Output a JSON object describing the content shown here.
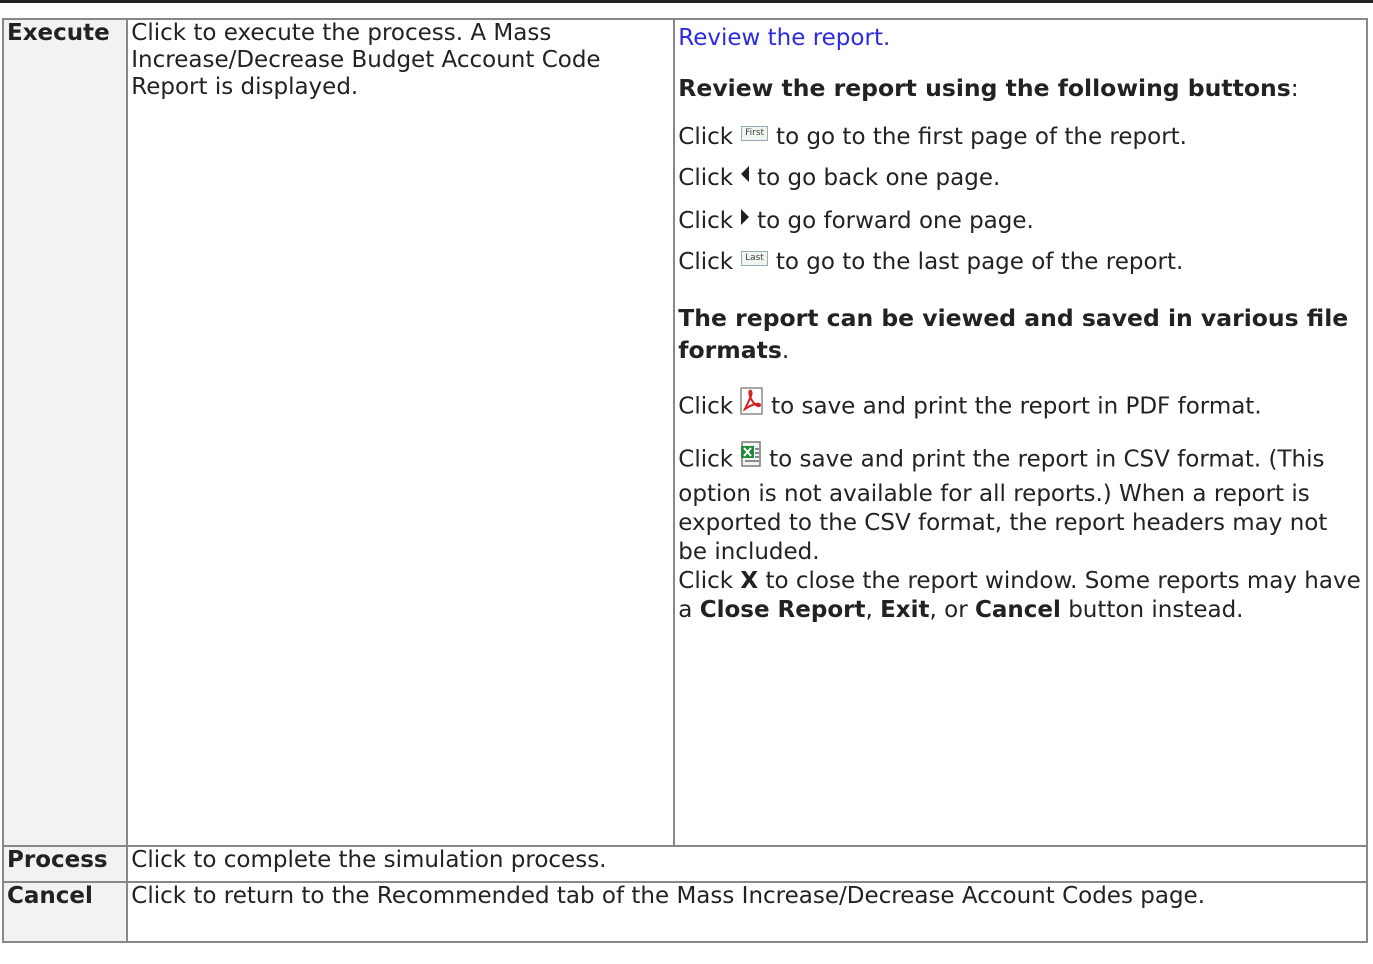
{
  "rows": [
    {
      "name": "Execute",
      "description": "Click to execute the process. A Mass Increase/Decrease Budget Account Code Report is displayed.",
      "details": {
        "link_text": "Review the report.",
        "heading1": "Review the report using the following buttons",
        "heading1_suffix": ":",
        "nav": [
          {
            "prefix": "Click",
            "button": "First",
            "text": "to go to the first page of the report."
          },
          {
            "prefix": "Click",
            "icon": "prev-triangle-icon",
            "text": "to go back one page."
          },
          {
            "prefix": "Click",
            "icon": "next-triangle-icon",
            "text": "to go forward one page."
          },
          {
            "prefix": "Click",
            "button": "Last",
            "text": "to go to the last page of the report."
          }
        ],
        "heading2": "The report can be viewed and saved in various file formats",
        "heading2_suffix": ".",
        "pdf": {
          "prefix": "Click",
          "text": "to save and print the report in PDF format."
        },
        "csv": {
          "prefix": "Click",
          "text": "to save and print the report in CSV format. (This option is not available for all reports.) When a report is exported to the CSV format, the report headers may not be included."
        },
        "close": {
          "p1": "Click ",
          "x": "X",
          "p2": " to close the report window. Some reports may have a ",
          "b1": "Close Report",
          "p3": ", ",
          "b2": "Exit",
          "p4": ", or ",
          "b3": "Cancel",
          "p5": " button instead."
        }
      }
    },
    {
      "name": "Process",
      "description": "Click to complete the simulation process."
    },
    {
      "name": "Cancel",
      "description": "Click to return to the Recommended tab of the Mass Increase/Decrease Account Codes page."
    }
  ]
}
